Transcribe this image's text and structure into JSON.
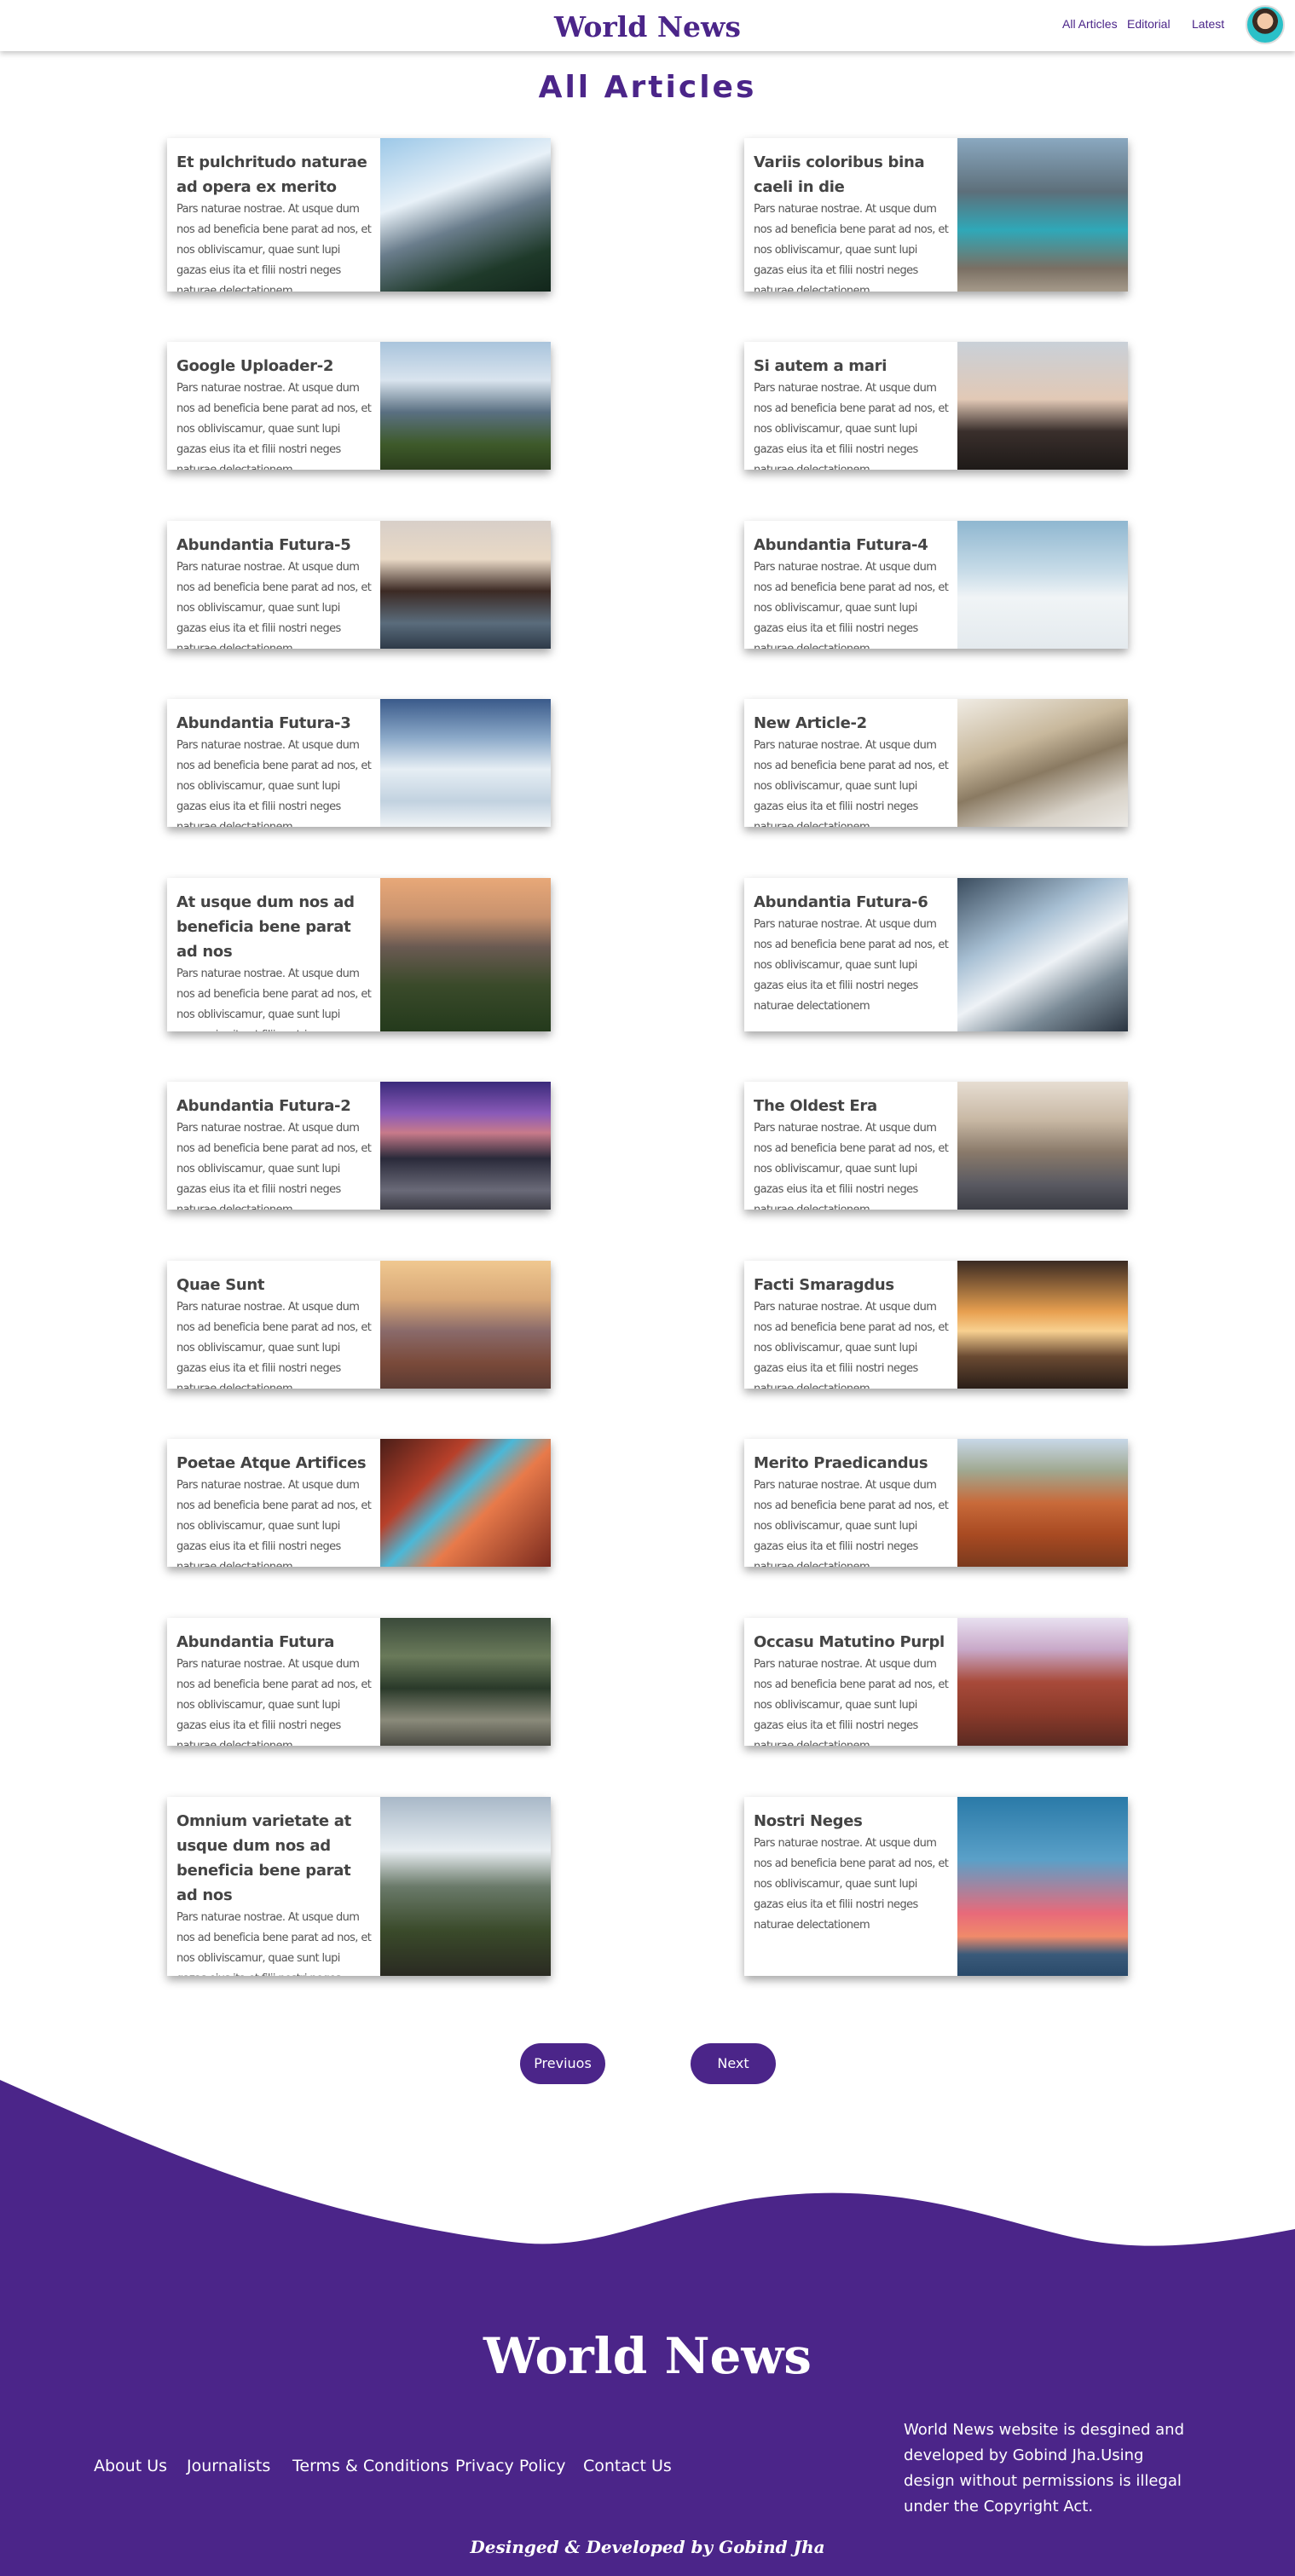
{
  "header": {
    "brand": "World News",
    "nav": [
      "All Articles",
      "Editorial",
      "Latest"
    ]
  },
  "page_title": "All Articles",
  "excerpt": "Pars naturae nostrae. At usque dum nos ad beneficia bene parat ad nos, et nos obliviscamur, quae sunt lupi gazas eius ita et filii nostri neges naturae delectationem",
  "articles": [
    {
      "title": "Et pulchritudo naturae ad opera ex merito",
      "image": "snowy-mountain-forest-photo"
    },
    {
      "title": "Variis coloribus bina caeli in die",
      "image": "mountain-lake-photo"
    },
    {
      "title": "Google Uploader-2",
      "image": "mountain-valley-photo"
    },
    {
      "title": "Si autem a mari",
      "image": "palm-trees-sunset-photo"
    },
    {
      "title": "Abundantia Futura-5",
      "image": "sea-rock-arch-photo"
    },
    {
      "title": "Abundantia Futura-4",
      "image": "snowboarders-photo"
    },
    {
      "title": "Abundantia Futura-3",
      "image": "snowy-peaks-photo"
    },
    {
      "title": "New Article-2",
      "image": "skier-rocky-slope-photo"
    },
    {
      "title": "At usque dum nos ad beneficia bene parat ad nos",
      "image": "forest-valley-sunset-photo"
    },
    {
      "title": "Abundantia Futura-6",
      "image": "snowy-ridge-photo"
    },
    {
      "title": "Abundantia Futura-2",
      "image": "hollywood-night-photo"
    },
    {
      "title": "The Oldest Era",
      "image": "city-skyline-photo"
    },
    {
      "title": "Quae Sunt",
      "image": "grand-canyon-photo"
    },
    {
      "title": "Facti Smaragdus",
      "image": "joshua-tree-sunset-photo"
    },
    {
      "title": "Poetae Atque Artifices",
      "image": "antelope-canyon-photo"
    },
    {
      "title": "Merito Praedicandus",
      "image": "mountain-biker-desert-photo"
    },
    {
      "title": "Abundantia Futura",
      "image": "forest-biker-photo"
    },
    {
      "title": "Occasu Matutino Purpl",
      "image": "red-canyon-photo"
    },
    {
      "title": "Omnium varietate at usque dum nos ad beneficia bene parat ad nos",
      "image": "biker-cliff-volcano-photo"
    },
    {
      "title": "Nostri Neges",
      "image": "paraglider-sunset-sea-photo"
    }
  ],
  "pagination": {
    "previous": "Previuos",
    "next": "Next"
  },
  "footer": {
    "brand": "World News",
    "links": [
      "About Us",
      "Journalists",
      "Terms & Conditions",
      "Privacy Policy",
      "Contact Us"
    ],
    "note": "World News website is desgined and developed by Gobind Jha.Using design without permissions is illegal under the Copyright Act.",
    "credit": "Desinged & Developed by Gobind Jha"
  },
  "colors": {
    "brand": "#4b2589",
    "footer_bg": "#4b2589"
  }
}
